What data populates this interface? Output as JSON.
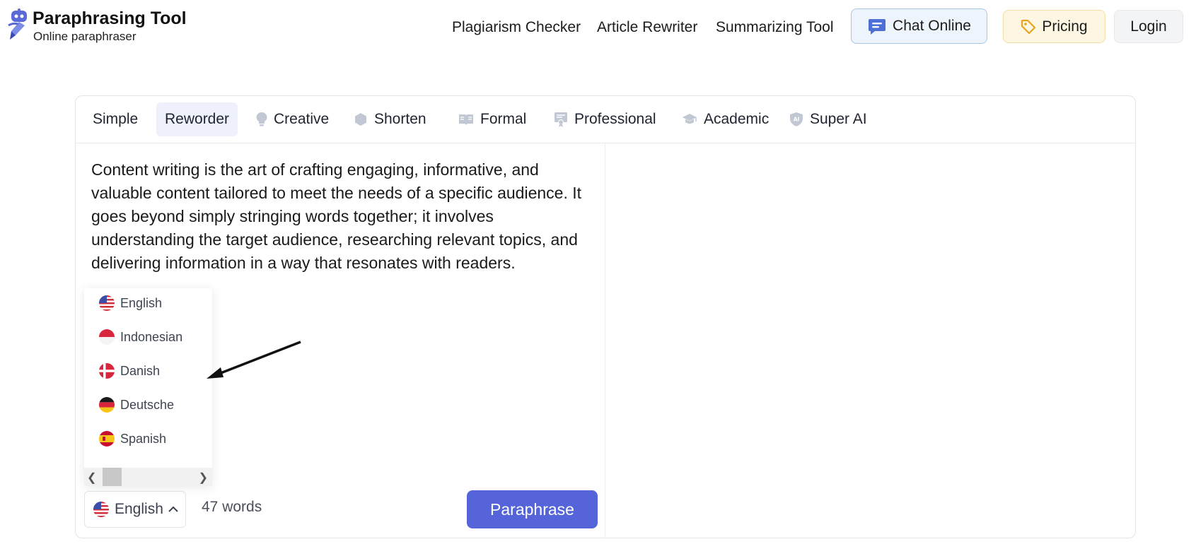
{
  "header": {
    "logo_title": "Paraphrasing Tool",
    "logo_subtitle": "Online paraphraser",
    "nav": {
      "plagiarism": "Plagiarism Checker",
      "rewriter": "Article Rewriter",
      "summarizing": "Summarizing Tool"
    },
    "chat_label": "Chat Online",
    "pricing_label": "Pricing",
    "login_label": "Login"
  },
  "tabs": [
    {
      "label": "Simple",
      "icon": null
    },
    {
      "label": "Reworder",
      "icon": null,
      "active": true
    },
    {
      "label": "Creative",
      "icon": "lightbulb-icon"
    },
    {
      "label": "Shorten",
      "icon": "hexagon-icon"
    },
    {
      "label": "Formal",
      "icon": "book-icon"
    },
    {
      "label": "Professional",
      "icon": "certificate-icon"
    },
    {
      "label": "Academic",
      "icon": "graduation-cap-icon"
    },
    {
      "label": "Super AI",
      "icon": "ai-shield-icon"
    }
  ],
  "editor": {
    "input_text": "Content writing is the art of crafting engaging, informative, and valuable content tailored to meet the needs of a specific audience. It goes beyond simply stringing words together; it involves understanding the target audience, researching relevant topics, and delivering information in a way that resonates with readers.",
    "word_count": "47 words",
    "paraphrase_label": "Paraphrase",
    "language_selected": "English"
  },
  "language_dropdown": {
    "options": [
      {
        "label": "English",
        "flag": "us-flag-icon"
      },
      {
        "label": "Indonesian",
        "flag": "indonesia-flag-icon"
      },
      {
        "label": "Danish",
        "flag": "denmark-flag-icon"
      },
      {
        "label": "Deutsche",
        "flag": "germany-flag-icon"
      },
      {
        "label": "Spanish",
        "flag": "spain-flag-icon"
      }
    ]
  },
  "colors": {
    "accent": "#5664d9",
    "active_tab_bg": "#eef0fb",
    "chat_bg": "#eef4fc",
    "pricing_bg": "#fdf6e3"
  }
}
